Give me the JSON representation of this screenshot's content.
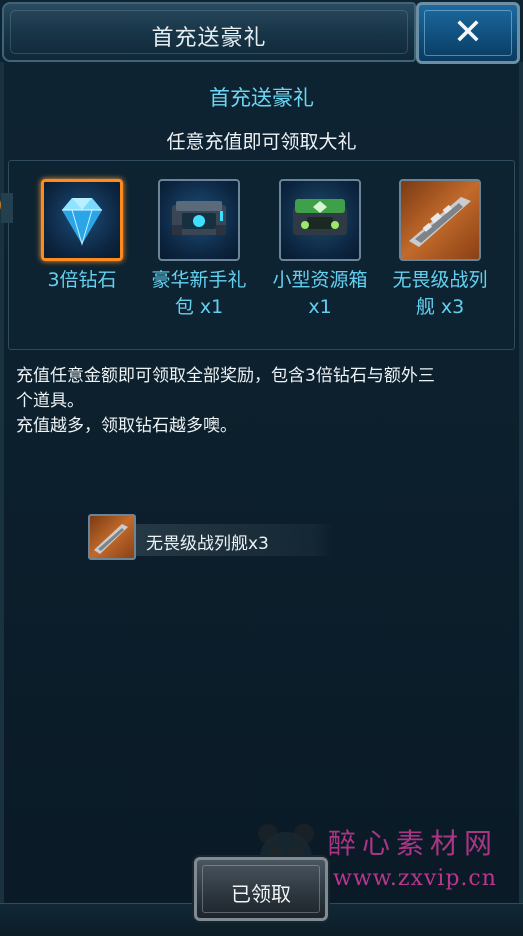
{
  "header": {
    "title": "首充送豪礼"
  },
  "close_button": {
    "icon": "close-icon"
  },
  "subtitle": "首充送豪礼",
  "description": "任意充值即可领取大礼",
  "rewards": [
    {
      "name": "3倍钻石",
      "icon": "diamond-icon"
    },
    {
      "name": "豪华新手礼包 x1",
      "icon": "deluxe-crate-icon"
    },
    {
      "name": "小型资源箱x1",
      "icon": "resource-crate-icon"
    },
    {
      "name": "无畏级战列舰 x3",
      "icon": "battleship-icon"
    }
  ],
  "reward_lines": [
    [
      "3倍钻石"
    ],
    [
      "豪华新手礼",
      "包 x1"
    ],
    [
      "小型资源箱",
      "x1"
    ],
    [
      "无畏级战列",
      "舰 x3"
    ]
  ],
  "body": {
    "line1": "充值任意金额即可领取全部奖励，包含3倍钻石与额外三",
    "line2": "个道具。",
    "line3": "充值越多，领取钻石越多噢。"
  },
  "claim_item": {
    "label": "无畏级战列舰x3",
    "icon": "battleship-icon"
  },
  "footer": {
    "button_label": "已领取"
  },
  "watermark": {
    "text": "醉心素材网",
    "url": "www.zxvip.cn"
  },
  "colors": {
    "accent_cyan": "#63d0f0",
    "selected_border": "#ff8a1e",
    "watermark": "#d73ca0"
  }
}
